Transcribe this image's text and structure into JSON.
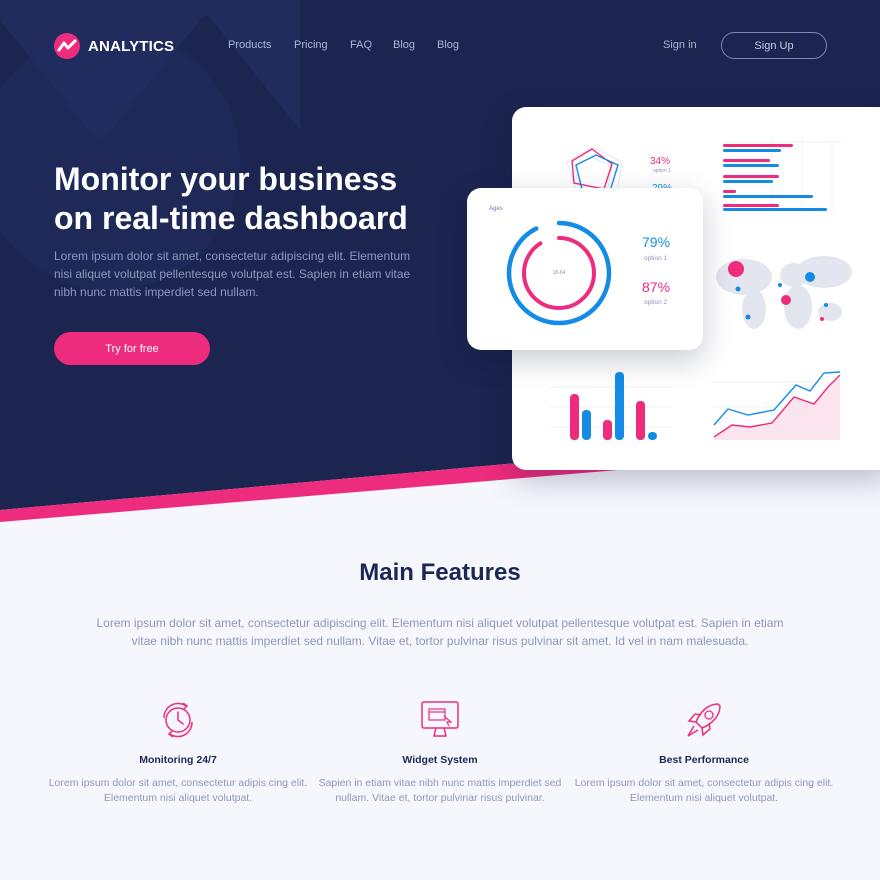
{
  "brand": {
    "name": "ANALYTICS",
    "accent": "#ee2c7d",
    "navy": "#1c2550",
    "blue": "#148ce6"
  },
  "nav": {
    "links": [
      "Products",
      "Pricing",
      "FAQ",
      "Blog",
      "Blog"
    ],
    "signin": "Sign in",
    "signup": "Sign Up"
  },
  "hero": {
    "title_line1": "Monitor your business",
    "title_line2": "on real-time dashboard",
    "description": "Lorem ipsum dolor sit amet, consectetur adipiscing elit. Elementum nisi aliquet volutpat pellentesque volutpat est. Sapien in etiam vitae nibh nunc mattis imperdiet sed nullam.",
    "cta": "Try for free"
  },
  "dashboard": {
    "ages_card": {
      "label": "Ages",
      "center_label": "18-64",
      "option1": {
        "pct": "79%",
        "label": "option 1"
      },
      "option2": {
        "pct": "87%",
        "label": "option 2"
      }
    },
    "radar_card": {
      "pct": "34%",
      "label": "option 1"
    }
  },
  "features": {
    "title": "Main Features",
    "description": "Lorem ipsum dolor sit amet, consectetur adipiscing elit. Elementum nisi aliquet volutpat pellentesque volutpat est. Sapien in etiam vitae nibh nunc mattis imperdiet sed nullam. Vitae et, tortor pulvinar risus pulvinar sit amet. Id vel in nam malesuada.",
    "items": [
      {
        "title": "Monitoring 24/7",
        "text": "Lorem ipsum dolor sit amet, consectetur adipis cing elit. Elementum nisi aliquet volutpat.",
        "icon": "clock-icon"
      },
      {
        "title": "Widget System",
        "text": "Sapien in etiam vitae nibh nunc mattis imperdiet sed nullam. Vitae et, tortor pulvinar risus pulvinar.",
        "icon": "monitor-icon"
      },
      {
        "title": "Best Performance",
        "text": "Lorem ipsum dolor sit amet, consectetur adipis cing elit. Elementum nisi aliquet volutpat.",
        "icon": "rocket-icon"
      }
    ]
  }
}
